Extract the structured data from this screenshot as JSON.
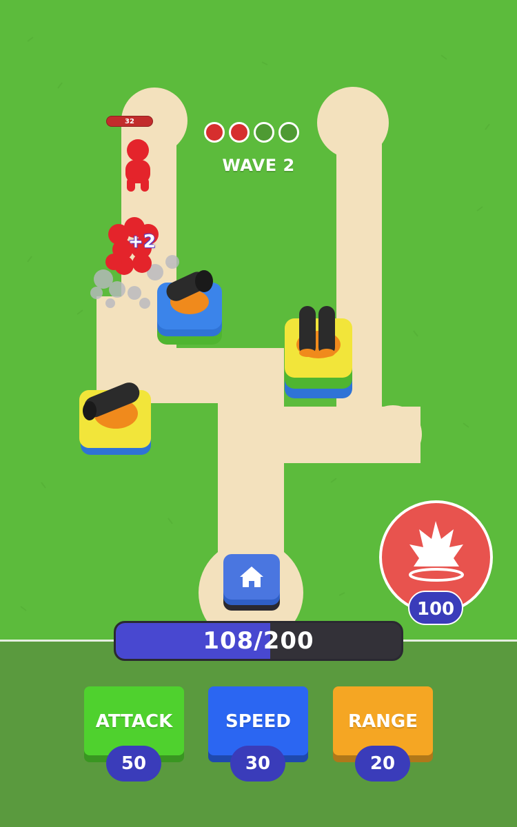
{
  "hud": {
    "wave_label": "WAVE 2",
    "wave_dots": [
      "done",
      "done",
      "pending",
      "pending"
    ],
    "enemy_hp": "32",
    "plus_label": "+2"
  },
  "progress": {
    "text": "108/200",
    "current": 108,
    "max": 200
  },
  "special": {
    "cost": "100",
    "icon": "explosion-icon"
  },
  "base": {
    "icon": "home-icon"
  },
  "upgrades": [
    {
      "label": "ATTACK",
      "cost": "50",
      "color": "#4fd12e"
    },
    {
      "label": "SPEED",
      "cost": "30",
      "color": "#2b66f2"
    },
    {
      "label": "RANGE",
      "cost": "20",
      "color": "#f5a623"
    }
  ],
  "colors": {
    "grass": "#5cbb3c",
    "path": "#f3e1bd",
    "panel": "#5a9a3e",
    "enemy": "#e4242b",
    "badge": "#3a3cba"
  }
}
